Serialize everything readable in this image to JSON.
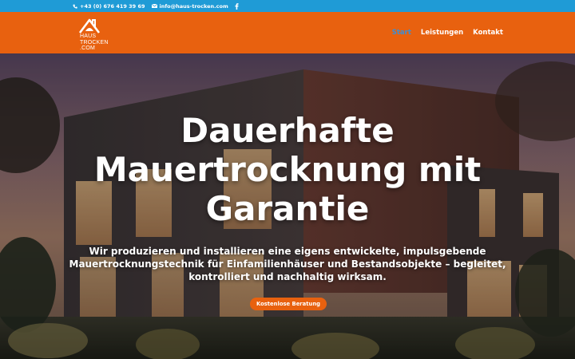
{
  "topbar": {
    "phone": "+43 (0) 676 419 39 69",
    "email": "info@haus-trocken.com",
    "social_icon": "facebook-icon"
  },
  "brand": {
    "logo_lines": [
      "HAUS",
      "TROCKEN",
      ".COM"
    ]
  },
  "nav": {
    "items": [
      {
        "label": "Start",
        "active": true
      },
      {
        "label": "Leistungen",
        "active": false
      },
      {
        "label": "Kontakt",
        "active": false
      }
    ]
  },
  "hero": {
    "title": "Dauerhafte Mauertrocknung mit Garantie",
    "subtitle": "Wir produzieren und installieren eine eigens entwickelte, impulsgebende Mauertrocknungstechnik für Einfamilienhäuser und Bestandsobjekte – begleitet, kontrolliert und nachhaltig wirksam.",
    "cta_label": "Kostenlose Beratung"
  },
  "colors": {
    "topbar": "#1f9bd6",
    "header": "#e8610f",
    "nav_active": "#3b8fd6",
    "cta": "#e8610f"
  }
}
